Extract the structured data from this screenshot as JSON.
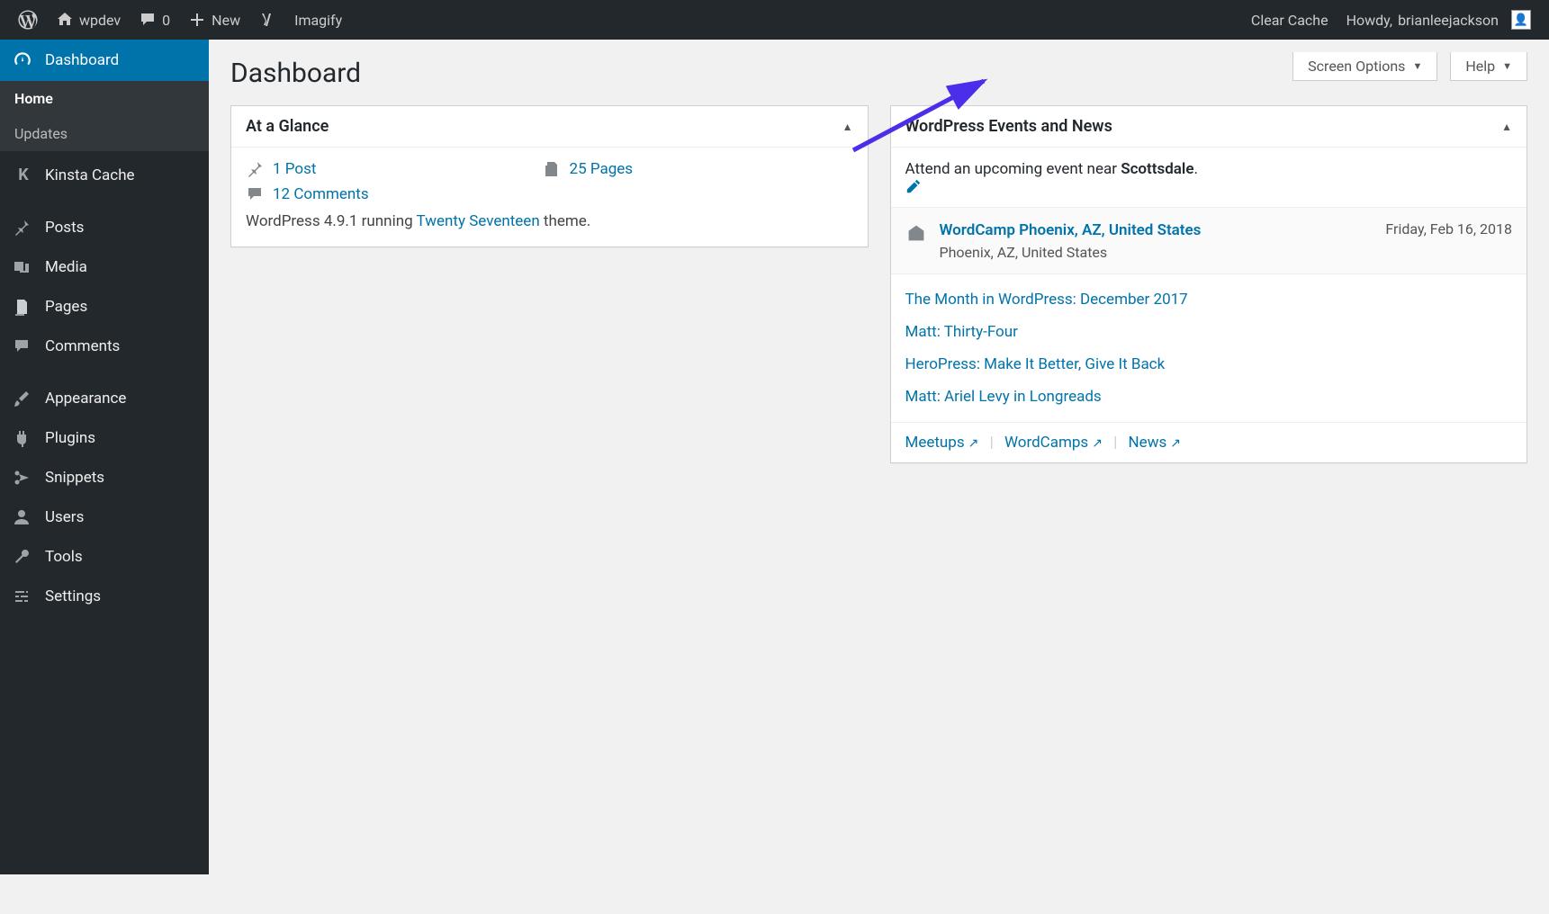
{
  "adminbar": {
    "site_name": "wpdev",
    "comment_count": "0",
    "new_label": "New",
    "imagify_label": "Imagify",
    "clear_cache": "Clear Cache",
    "howdy_prefix": "Howdy, ",
    "username": "brianleejackson"
  },
  "sidebar": {
    "items": [
      {
        "label": "Dashboard",
        "icon": "dashboard",
        "current": true,
        "sub": [
          {
            "label": "Home",
            "current": true
          },
          {
            "label": "Updates",
            "current": false
          }
        ]
      },
      {
        "label": "Kinsta Cache",
        "icon": "kinsta"
      },
      {
        "label": "Posts",
        "icon": "pin"
      },
      {
        "label": "Media",
        "icon": "media"
      },
      {
        "label": "Pages",
        "icon": "pages"
      },
      {
        "label": "Comments",
        "icon": "comment"
      },
      {
        "label": "Appearance",
        "icon": "brush"
      },
      {
        "label": "Plugins",
        "icon": "plug"
      },
      {
        "label": "Snippets",
        "icon": "scissors"
      },
      {
        "label": "Users",
        "icon": "user"
      },
      {
        "label": "Tools",
        "icon": "wrench"
      },
      {
        "label": "Settings",
        "icon": "sliders"
      }
    ]
  },
  "page": {
    "title": "Dashboard",
    "screen_options": "Screen Options",
    "help": "Help"
  },
  "glance": {
    "title": "At a Glance",
    "posts": "1 Post",
    "pages": "25 Pages",
    "comments": "12 Comments",
    "version_prefix": "WordPress 4.9.1 running ",
    "theme": "Twenty Seventeen",
    "version_suffix": " theme."
  },
  "events": {
    "title": "WordPress Events and News",
    "location_prefix": "Attend an upcoming event near ",
    "location": "Scottsdale",
    "location_suffix": ".",
    "event_title": "WordCamp Phoenix, AZ, United States",
    "event_sub": "Phoenix, AZ, United States",
    "event_date": "Friday, Feb 16, 2018",
    "news": [
      "The Month in WordPress: December 2017",
      "Matt: Thirty-Four",
      "HeroPress: Make It Better, Give It Back",
      "Matt: Ariel Levy in Longreads"
    ],
    "footer": {
      "meetups": "Meetups",
      "wordcamps": "WordCamps",
      "news": "News"
    }
  }
}
